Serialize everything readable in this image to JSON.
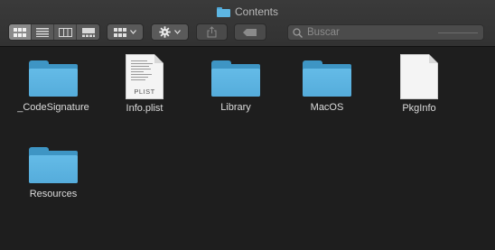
{
  "window": {
    "title": "Contents"
  },
  "toolbar": {
    "view_modes": [
      "icon-view",
      "list-view",
      "column-view",
      "gallery-view"
    ],
    "active_view": "icon-view",
    "search": {
      "placeholder": "Buscar",
      "value": ""
    }
  },
  "files": [
    {
      "name": "_CodeSignature",
      "kind": "folder"
    },
    {
      "name": "Info.plist",
      "kind": "document",
      "tag": "PLIST"
    },
    {
      "name": "Library",
      "kind": "folder"
    },
    {
      "name": "MacOS",
      "kind": "folder"
    },
    {
      "name": "PkgInfo",
      "kind": "blank-document"
    },
    {
      "name": "Resources",
      "kind": "folder"
    }
  ],
  "colors": {
    "folder_front": "#5db6e3",
    "folder_back": "#3e95c4",
    "window_bg": "#1e1e1e",
    "toolbar_bg": "#3a3a3a"
  }
}
